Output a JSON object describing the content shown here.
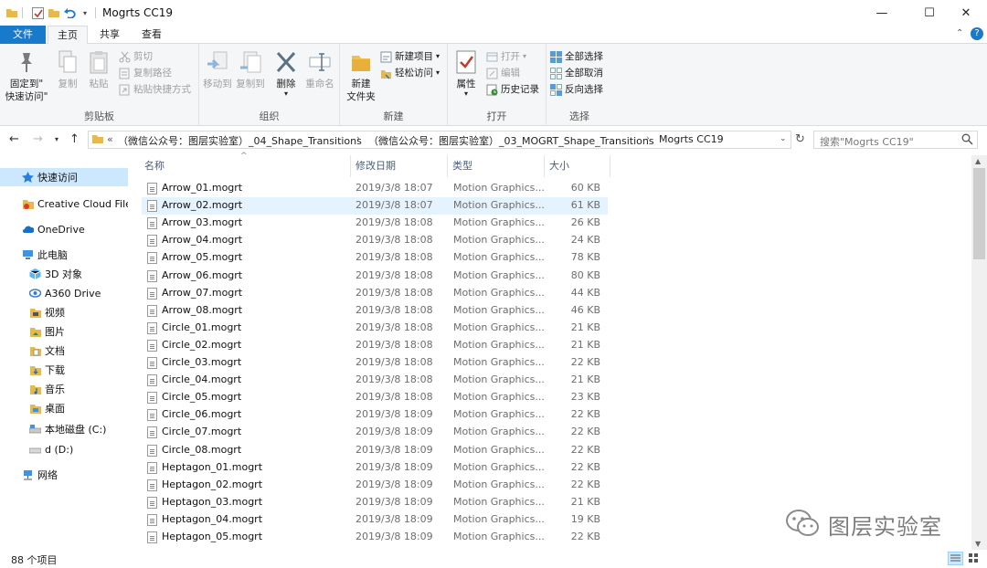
{
  "window": {
    "title": "Mogrts CC19",
    "controls": {
      "minimize": "—",
      "maximize": "☐",
      "close": "✕"
    }
  },
  "tabs": [
    {
      "label": "文件"
    },
    {
      "label": "主页"
    },
    {
      "label": "共享"
    },
    {
      "label": "查看"
    }
  ],
  "ribbon": {
    "clipboard": {
      "label": "剪贴板",
      "pin_line1": "固定到\"",
      "pin_line2": "快速访问\"",
      "copy": "复制",
      "paste": "粘贴",
      "cut": "剪切",
      "copy_path": "复制路径",
      "paste_shortcut": "粘贴快捷方式"
    },
    "organize": {
      "label": "组织",
      "move_to": "移动到",
      "copy_to": "复制到",
      "delete": "删除",
      "rename": "重命名"
    },
    "new": {
      "label": "新建",
      "new_folder_line1": "新建",
      "new_folder_line2": "文件夹",
      "new_item": "新建项目",
      "easy_access": "轻松访问"
    },
    "open": {
      "label": "打开",
      "properties": "属性",
      "open": "打开",
      "edit": "编辑",
      "history": "历史记录"
    },
    "select": {
      "label": "选择",
      "select_all": "全部选择",
      "select_none": "全部取消",
      "invert": "反向选择"
    }
  },
  "address": {
    "crumbs": [
      "«",
      "（微信公众号：图层实验室）_04_Shape_Transitions",
      "（微信公众号：图层实验室）_03_MOGRT_Shape_Transitions",
      "Mogrts CC19"
    ],
    "search_placeholder": "搜索\"Mogrts CC19\""
  },
  "navpane": [
    {
      "label": "快速访问",
      "icon": "star-icon",
      "indent": 1,
      "selected": true
    },
    {
      "label": "Creative Cloud Files",
      "icon": "creative-cloud-icon",
      "indent": 1
    },
    {
      "label": "OneDrive",
      "icon": "cloud-icon",
      "indent": 1
    },
    {
      "label": "此电脑",
      "icon": "computer-icon",
      "indent": 1
    },
    {
      "label": "3D 对象",
      "icon": "cube-icon",
      "indent": 2
    },
    {
      "label": "A360 Drive",
      "icon": "a360-icon",
      "indent": 2
    },
    {
      "label": "视频",
      "icon": "video-icon",
      "indent": 2
    },
    {
      "label": "图片",
      "icon": "pictures-icon",
      "indent": 2
    },
    {
      "label": "文档",
      "icon": "documents-icon",
      "indent": 2
    },
    {
      "label": "下载",
      "icon": "download-icon",
      "indent": 2
    },
    {
      "label": "音乐",
      "icon": "music-icon",
      "indent": 2
    },
    {
      "label": "桌面",
      "icon": "desktop-icon",
      "indent": 2
    },
    {
      "label": "本地磁盘 (C:)",
      "icon": "drive-icon",
      "indent": 2
    },
    {
      "label": "d (D:)",
      "icon": "drive-icon",
      "indent": 2
    },
    {
      "label": "网络",
      "icon": "network-icon",
      "indent": 1
    }
  ],
  "columns": {
    "name": "名称",
    "date": "修改日期",
    "type": "类型",
    "size": "大小"
  },
  "files": [
    {
      "name": "Arrow_01.mogrt",
      "date": "2019/3/8 18:07",
      "type": "Motion Graphics...",
      "size": "60 KB"
    },
    {
      "name": "Arrow_02.mogrt",
      "date": "2019/3/8 18:07",
      "type": "Motion Graphics...",
      "size": "61 KB",
      "selected": true
    },
    {
      "name": "Arrow_03.mogrt",
      "date": "2019/3/8 18:08",
      "type": "Motion Graphics...",
      "size": "26 KB"
    },
    {
      "name": "Arrow_04.mogrt",
      "date": "2019/3/8 18:08",
      "type": "Motion Graphics...",
      "size": "24 KB"
    },
    {
      "name": "Arrow_05.mogrt",
      "date": "2019/3/8 18:08",
      "type": "Motion Graphics...",
      "size": "78 KB"
    },
    {
      "name": "Arrow_06.mogrt",
      "date": "2019/3/8 18:08",
      "type": "Motion Graphics...",
      "size": "80 KB"
    },
    {
      "name": "Arrow_07.mogrt",
      "date": "2019/3/8 18:08",
      "type": "Motion Graphics...",
      "size": "44 KB"
    },
    {
      "name": "Arrow_08.mogrt",
      "date": "2019/3/8 18:08",
      "type": "Motion Graphics...",
      "size": "46 KB"
    },
    {
      "name": "Circle_01.mogrt",
      "date": "2019/3/8 18:08",
      "type": "Motion Graphics...",
      "size": "21 KB"
    },
    {
      "name": "Circle_02.mogrt",
      "date": "2019/3/8 18:08",
      "type": "Motion Graphics...",
      "size": "21 KB"
    },
    {
      "name": "Circle_03.mogrt",
      "date": "2019/3/8 18:08",
      "type": "Motion Graphics...",
      "size": "22 KB"
    },
    {
      "name": "Circle_04.mogrt",
      "date": "2019/3/8 18:08",
      "type": "Motion Graphics...",
      "size": "21 KB"
    },
    {
      "name": "Circle_05.mogrt",
      "date": "2019/3/8 18:08",
      "type": "Motion Graphics...",
      "size": "23 KB"
    },
    {
      "name": "Circle_06.mogrt",
      "date": "2019/3/8 18:09",
      "type": "Motion Graphics...",
      "size": "22 KB"
    },
    {
      "name": "Circle_07.mogrt",
      "date": "2019/3/8 18:09",
      "type": "Motion Graphics...",
      "size": "22 KB"
    },
    {
      "name": "Circle_08.mogrt",
      "date": "2019/3/8 18:09",
      "type": "Motion Graphics...",
      "size": "22 KB"
    },
    {
      "name": "Heptagon_01.mogrt",
      "date": "2019/3/8 18:09",
      "type": "Motion Graphics...",
      "size": "22 KB"
    },
    {
      "name": "Heptagon_02.mogrt",
      "date": "2019/3/8 18:09",
      "type": "Motion Graphics...",
      "size": "22 KB"
    },
    {
      "name": "Heptagon_03.mogrt",
      "date": "2019/3/8 18:09",
      "type": "Motion Graphics...",
      "size": "21 KB"
    },
    {
      "name": "Heptagon_04.mogrt",
      "date": "2019/3/8 18:09",
      "type": "Motion Graphics...",
      "size": "19 KB"
    },
    {
      "name": "Heptagon_05.mogrt",
      "date": "2019/3/8 18:09",
      "type": "Motion Graphics...",
      "size": "22 KB"
    }
  ],
  "status": {
    "count": "88 个项目"
  },
  "watermark": {
    "text": "图层实验室"
  },
  "colors": {
    "accent": "#1979ca",
    "selected_nav": "#cce8ff",
    "selected_row": "#e5f3ff"
  }
}
